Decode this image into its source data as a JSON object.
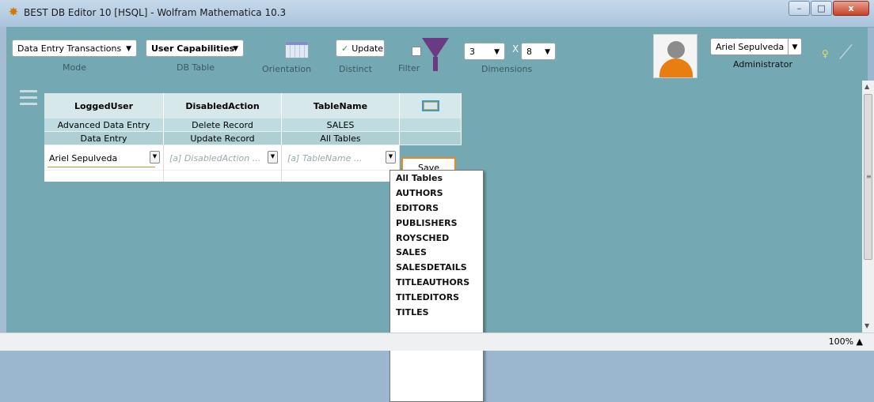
{
  "window": {
    "title": "BEST DB Editor 10 [HSQL] - Wolfram Mathematica 10.3",
    "minimize": "–",
    "maximize": "□",
    "close": "x"
  },
  "toolbar": {
    "mode_value": "Data Entry Transactions",
    "mode_caption": "Mode",
    "table_value": "User Capabilities",
    "table_caption": "DB Table",
    "orientation_caption": "Orientation",
    "update_label": "Update",
    "distinct_caption": "Distinct",
    "filter_caption": "Filter",
    "dim_rows": "3",
    "dim_x": "X",
    "dim_cols": "8",
    "dimensions_caption": "Dimensions",
    "user_name": "Ariel Sepulveda",
    "user_role": "Administrator"
  },
  "grid": {
    "columns": [
      "LoggedUser",
      "DisabledAction",
      "TableName"
    ],
    "rows": [
      [
        "Advanced Data Entry",
        "Delete Record",
        "SALES"
      ],
      [
        "Data Entry",
        "Update Record",
        "All Tables"
      ]
    ],
    "entry": {
      "logged_user": "Ariel Sepulveda",
      "disabled_action_placeholder": "[a] DisabledAction ...",
      "table_name_placeholder": "[a] TableName ..."
    },
    "save_label": "Save"
  },
  "dropdown": {
    "options": [
      "All Tables",
      "AUTHORS",
      "EDITORS",
      "PUBLISHERS",
      "ROYSCHED",
      "SALES",
      "SALESDETAILS",
      "TITLEAUTHORS",
      "TITLEDITORS",
      "TITLES"
    ]
  },
  "status": {
    "zoom": "100%"
  },
  "colors": {
    "panel": "#74a9b3",
    "accent": "#e38a2b",
    "avatar_body": "#e87d12"
  }
}
